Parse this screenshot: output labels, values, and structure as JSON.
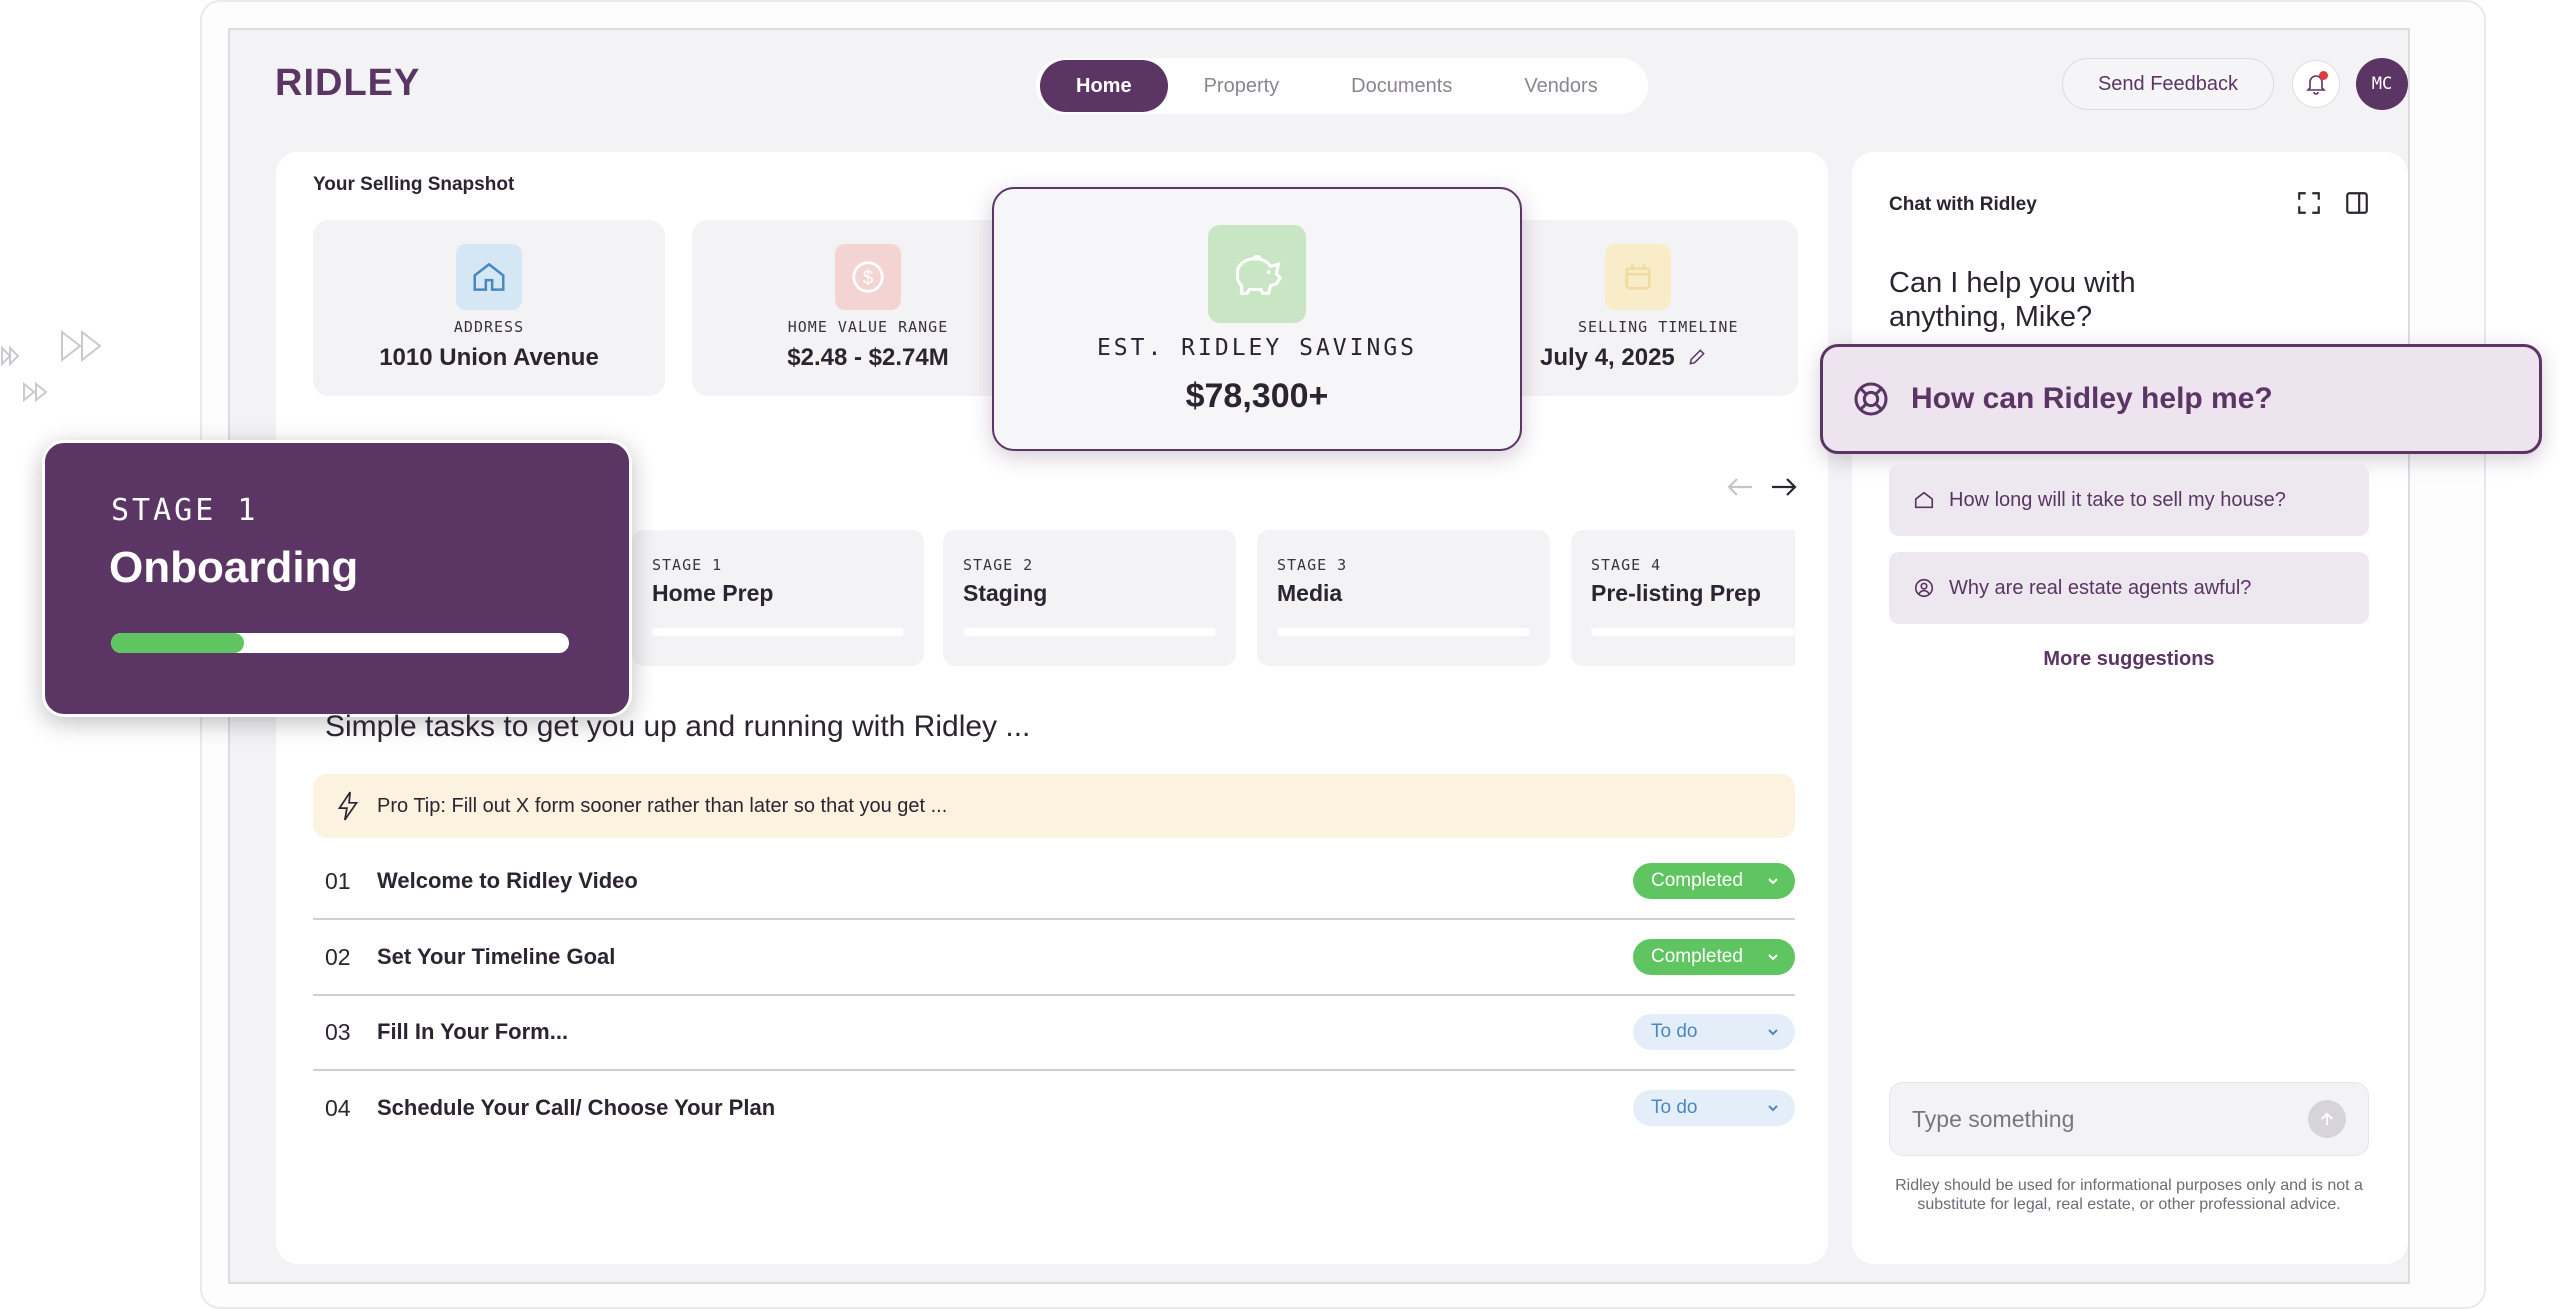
{
  "app": {
    "logo": "RIDLEY"
  },
  "nav": {
    "tabs": [
      {
        "label": "Home",
        "active": true
      },
      {
        "label": "Property",
        "active": false
      },
      {
        "label": "Documents",
        "active": false
      },
      {
        "label": "Vendors",
        "active": false
      }
    ]
  },
  "header": {
    "feedback_label": "Send Feedback",
    "avatar_initials": "MC",
    "notification_icon": "bell-icon"
  },
  "snapshot": {
    "title": "Your Selling Snapshot",
    "address": {
      "label": "ADDRESS",
      "value": "1010 Union Avenue",
      "icon": "house-icon"
    },
    "home_value": {
      "label": "HOME VALUE RANGE",
      "value": "$2.48 - $2.74M",
      "icon": "dollar-icon"
    },
    "savings": {
      "label": "EST. RIDLEY SAVINGS",
      "value": "$78,300+",
      "icon": "piggy-bank-icon"
    },
    "timeline": {
      "label": "SELLING TIMELINE",
      "value": "July 4, 2025",
      "icon": "calendar-icon"
    }
  },
  "stages": [
    {
      "num": "STAGE 1",
      "name": "Home Prep"
    },
    {
      "num": "STAGE 2",
      "name": "Staging"
    },
    {
      "num": "STAGE 3",
      "name": "Media"
    },
    {
      "num": "STAGE 4",
      "name": "Pre-listing Prep"
    }
  ],
  "current_stage": {
    "num": "STAGE 1",
    "name": "Onboarding",
    "progress": 0.29
  },
  "tasks": {
    "heading": "Simple tasks to get you up and running with Ridley ...",
    "protip": "Pro Tip: Fill out X form sooner rather than later so that you get ...",
    "items": [
      {
        "num": "01",
        "title": "Welcome to Ridley Video",
        "status": "Completed"
      },
      {
        "num": "02",
        "title": "Set Your Timeline Goal",
        "status": "Completed"
      },
      {
        "num": "03",
        "title": "Fill In Your Form...",
        "status": "To do"
      },
      {
        "num": "04",
        "title": "Schedule Your Call/ Choose Your Plan",
        "status": "To do"
      }
    ]
  },
  "chat": {
    "title": "Chat with Ridley",
    "greeting": "Can I help you with anything, Mike?",
    "help_prompt": "How can Ridley help me?",
    "suggestions": [
      {
        "text": "How long will it take to sell my house?",
        "icon": "house-icon"
      },
      {
        "text": "Why are real estate agents awful?",
        "icon": "user-icon"
      }
    ],
    "more_label": "More suggestions",
    "input_placeholder": "Type something",
    "disclaimer": "Ridley should be used for informational purposes only and is not a substitute for legal, real estate, or other professional advice."
  },
  "colors": {
    "brand": "#5b3563",
    "success": "#5fc560",
    "todo_bg": "#e3eef8",
    "tip_bg": "#fbf3df"
  }
}
